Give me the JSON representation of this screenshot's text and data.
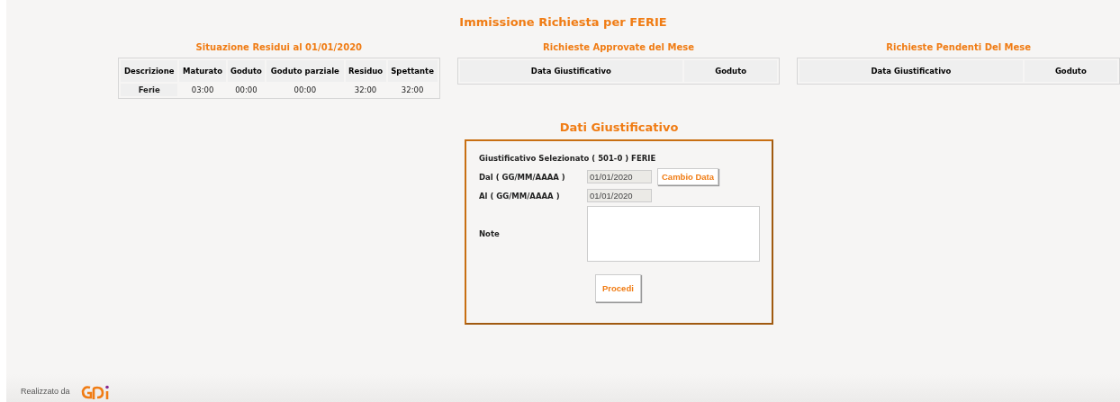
{
  "title": "Immissione Richiesta per FERIE",
  "residui": {
    "title": "Situazione Residui al 01/01/2020",
    "columns": [
      "Descrizione",
      "Maturato",
      "Goduto",
      "Goduto parziale",
      "Residuo",
      "Spettante"
    ],
    "rows": [
      [
        "Ferie",
        "03:00",
        "00:00",
        "00:00",
        "32:00",
        "32:00"
      ]
    ]
  },
  "approvate": {
    "title": "Richieste Approvate del Mese",
    "columns": [
      "Data Giustificativo",
      "Goduto"
    ]
  },
  "pendenti": {
    "title": "Richieste Pendenti Del Mese",
    "columns": [
      "Data Giustificativo",
      "Goduto"
    ]
  },
  "form": {
    "title": "Dati Giustificativo",
    "selected_label": "Giustificativo Selezionato ( 501-0 ) FERIE",
    "dal_label": "Dal ( GG/MM/AAAA )",
    "dal_value": "01/01/2020",
    "change_button": "Cambio Data",
    "al_label": "Al ( GG/MM/AAAA )",
    "al_value": "01/01/2020",
    "note_label": "Note",
    "submit": "Procedi"
  },
  "footer": {
    "text": "Realizzato da"
  }
}
